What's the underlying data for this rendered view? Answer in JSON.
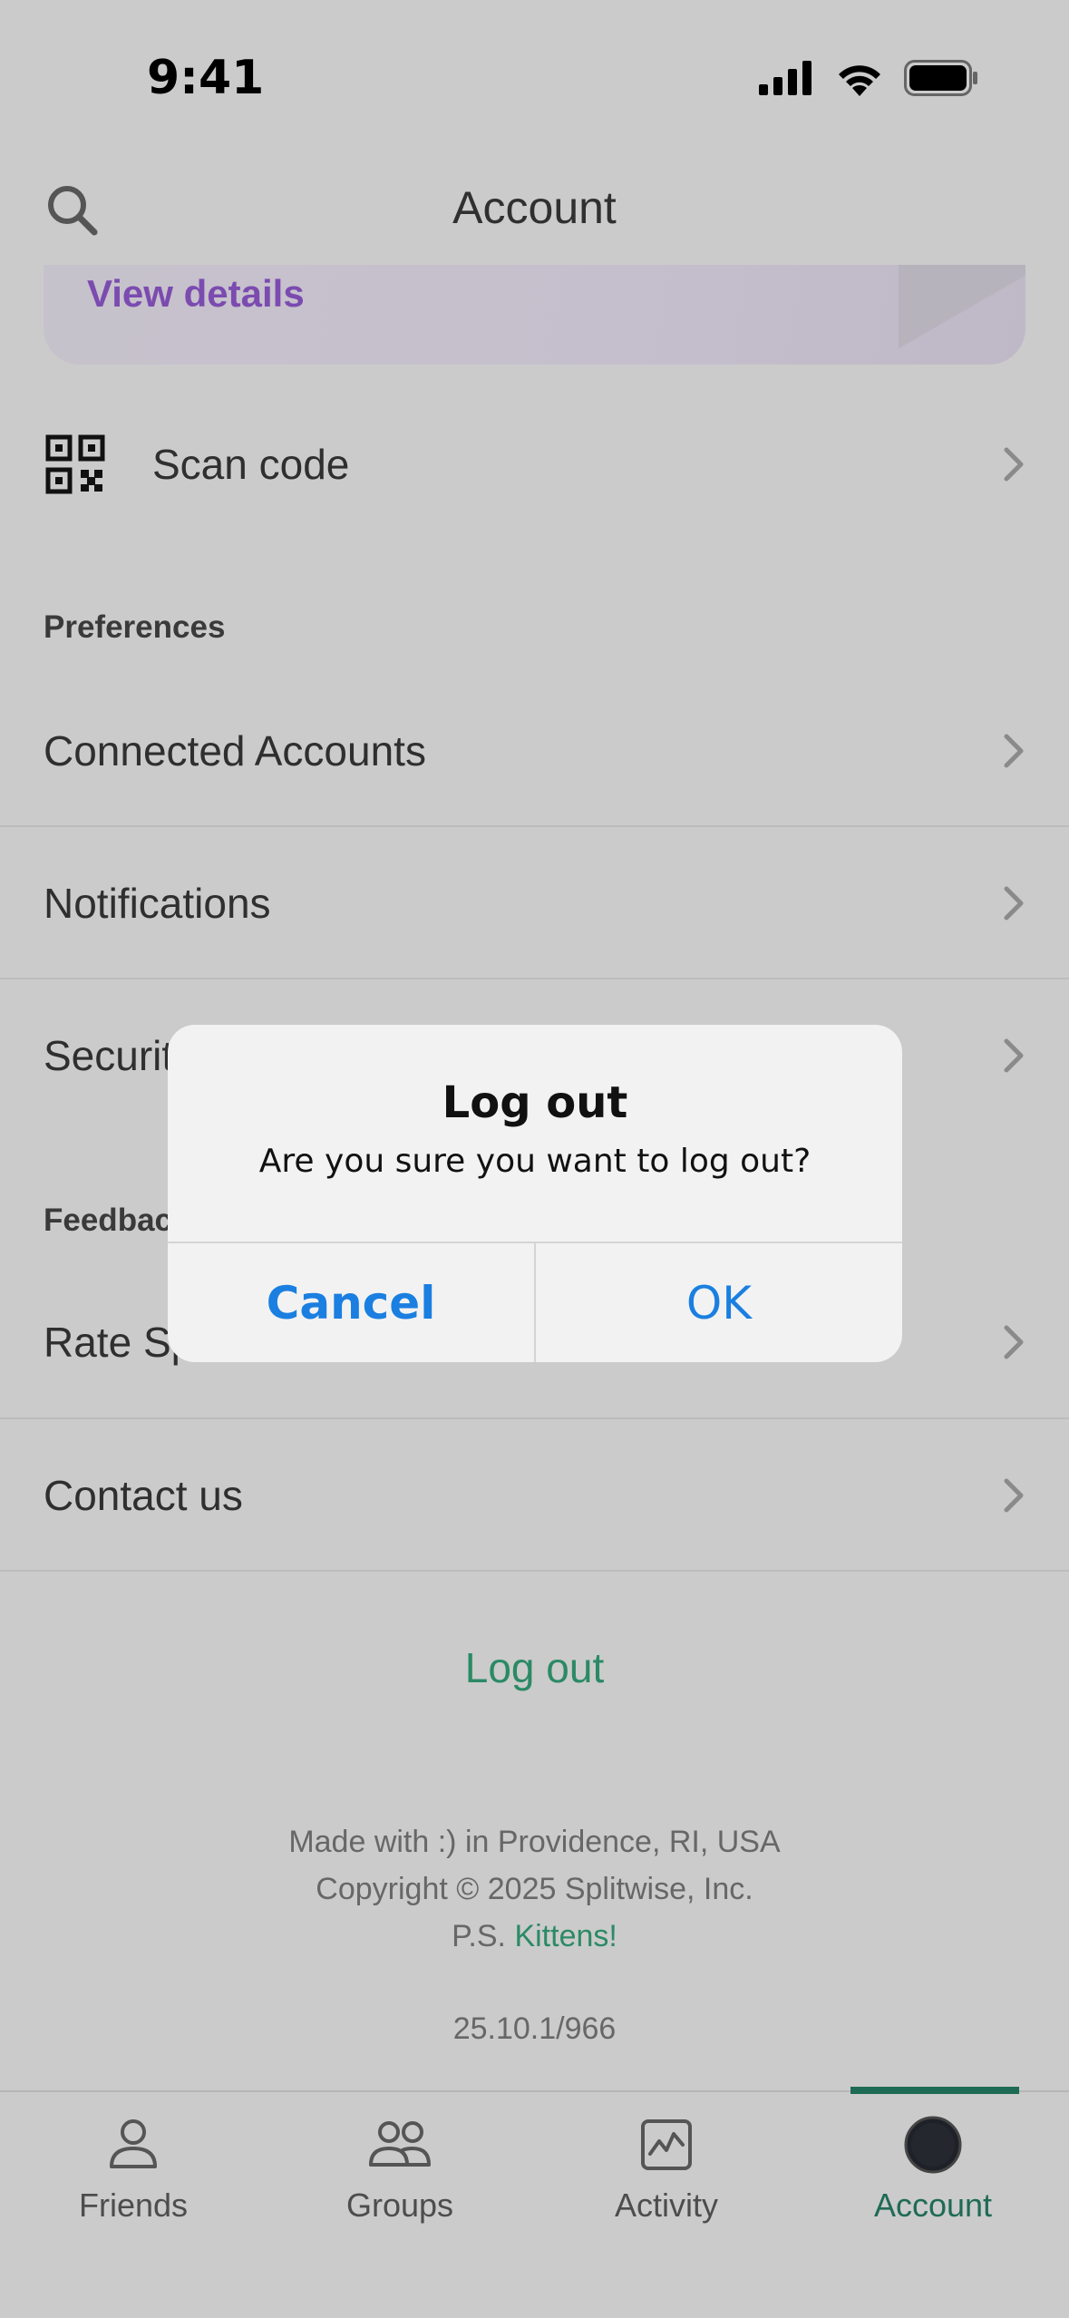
{
  "status_bar": {
    "time": "9:41"
  },
  "header": {
    "title": "Account"
  },
  "promo": {
    "link_label": "View details"
  },
  "scan": {
    "label": "Scan code"
  },
  "sections": {
    "preferences": "Preferences",
    "feedback": "Feedback"
  },
  "rows": {
    "connected_accounts": "Connected Accounts",
    "notifications": "Notifications",
    "security": "Security",
    "rate": "Rate Splitwise",
    "contact": "Contact us"
  },
  "logout": {
    "label": "Log out"
  },
  "footer": {
    "line1": "Made with :) in Providence, RI, USA",
    "line2": "Copyright © 2025 Splitwise, Inc.",
    "ps_prefix": "P.S. ",
    "ps_link": "Kittens!",
    "version": "25.10.1/966"
  },
  "tabs": [
    {
      "label": "Friends",
      "icon": "person-icon"
    },
    {
      "label": "Groups",
      "icon": "group-icon"
    },
    {
      "label": "Activity",
      "icon": "activity-icon"
    },
    {
      "label": "Account",
      "icon": "account-avatar-icon"
    }
  ],
  "alert": {
    "title": "Log out",
    "message": "Are you sure you want to log out?",
    "cancel_label": "Cancel",
    "ok_label": "OK"
  },
  "colors": {
    "accent": "#2b8a66",
    "promo_link": "#7b4bb0",
    "ios_blue": "#1a7fe0"
  }
}
